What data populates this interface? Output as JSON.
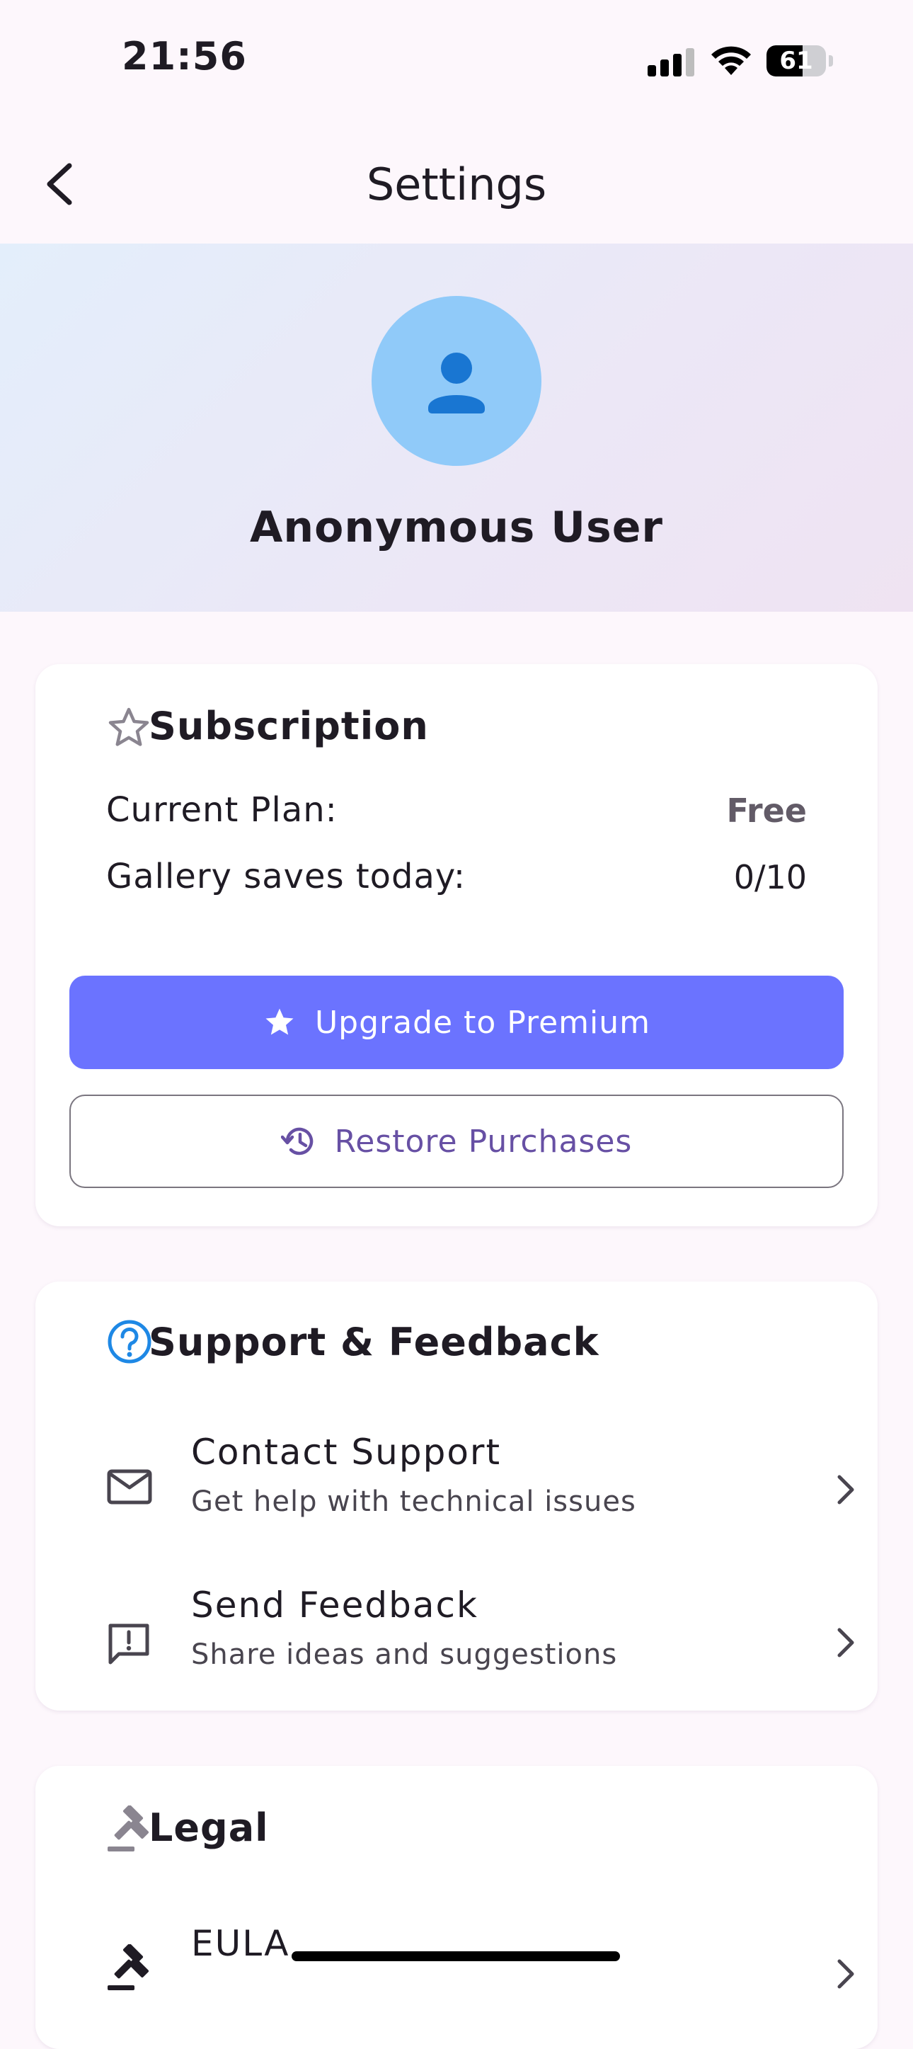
{
  "status_bar": {
    "time": "21:56",
    "battery": "61"
  },
  "app_bar": {
    "title": "Settings"
  },
  "profile": {
    "name": "Anonymous User"
  },
  "subscription": {
    "title": "Subscription",
    "plan_label": "Current Plan:",
    "plan_value": "Free",
    "saves_label": "Gallery saves today:",
    "saves_value": "0/10",
    "upgrade_label": "Upgrade to Premium",
    "restore_label": "Restore Purchases"
  },
  "support": {
    "title": "Support & Feedback",
    "items": [
      {
        "title": "Contact Support",
        "subtitle": "Get help with technical issues"
      },
      {
        "title": "Send Feedback",
        "subtitle": "Share ideas and suggestions"
      }
    ]
  },
  "legal": {
    "title": "Legal",
    "items": [
      {
        "title": "EULA"
      }
    ]
  },
  "colors": {
    "accent": "#6B73FF",
    "avatar_bg": "#90CAF9",
    "avatar_icon": "#1976D2",
    "primary_text": "#6750A4"
  }
}
